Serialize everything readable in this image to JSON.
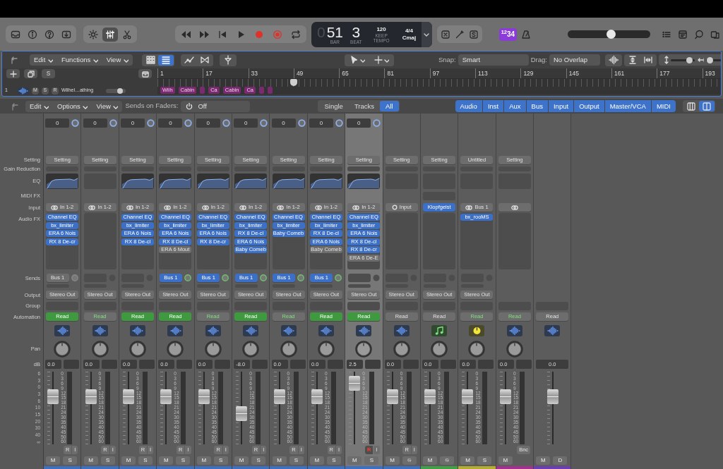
{
  "toolbar": {
    "view_buttons": [
      {
        "kind": "brightness",
        "selected": false
      },
      {
        "kind": "sliders",
        "selected": true
      },
      {
        "kind": "scissors",
        "selected": false
      }
    ],
    "lcd": {
      "dim_digit": "0",
      "bar": "51",
      "bar_label": "BAR",
      "beat": "3",
      "beat_label": "BEAT",
      "tempo": "120",
      "tempo_mode": "KEEP",
      "tempo_label": "TEMPO",
      "signature": "4/4",
      "key": "Cmaj"
    },
    "key_badge": "$^{12}$34",
    "master_volume": {
      "level": 0.52
    }
  },
  "tracks": {
    "menus": [
      "Edit",
      "Functions",
      "View"
    ],
    "view_toggle": [
      {
        "kind": "grid",
        "selected": false
      },
      {
        "kind": "list",
        "selected": true
      }
    ],
    "snap": {
      "label": "Snap:",
      "value": "Smart"
    },
    "drag": {
      "label": "Drag:",
      "value": "No Overlap"
    },
    "zoom": [
      {
        "kind": "vertical",
        "level": 0.78
      },
      {
        "kind": "horizontal",
        "level": 0.15
      }
    ],
    "header_button": "S",
    "ruler": [
      {
        "label": "1",
        "playhead": false
      },
      {
        "label": "17",
        "playhead": false
      },
      {
        "label": "33",
        "playhead": false
      },
      {
        "label": "49",
        "playhead": true
      },
      {
        "label": "65",
        "playhead": false
      },
      {
        "label": "81",
        "playhead": false
      },
      {
        "label": "97",
        "playhead": false
      },
      {
        "label": "113",
        "playhead": false
      },
      {
        "label": "129",
        "playhead": false
      },
      {
        "label": "145",
        "playhead": false
      },
      {
        "label": "161",
        "playhead": false
      },
      {
        "label": "177",
        "playhead": false
      },
      {
        "label": "193",
        "playhead": false
      }
    ],
    "track": {
      "number": "1",
      "buttons": [
        "M",
        "S",
        "R"
      ],
      "name": "Wilhel…athing",
      "volume": {
        "level": 0.7
      }
    },
    "regions": [
      {
        "kind": "labeled",
        "label": "Wilh"
      },
      {
        "kind": "labeled",
        "label": "Cabin"
      },
      {
        "kind": "blank"
      },
      {
        "kind": "labeled",
        "label": "Ca"
      },
      {
        "kind": "labeled",
        "label": "Cabin"
      },
      {
        "kind": "labeled",
        "label": "Ca"
      },
      {
        "kind": "blank"
      },
      {
        "kind": "blank"
      }
    ]
  },
  "mixer_header": {
    "menus": [
      "Edit",
      "Options",
      "View"
    ],
    "sends_on_faders": {
      "label": "Sends on Faders:",
      "value": "Off"
    },
    "scope": [
      {
        "label": "Single",
        "selected": false
      },
      {
        "label": "Tracks",
        "selected": false
      },
      {
        "label": "All",
        "selected": true
      }
    ],
    "filters": [
      {
        "label": "Audio",
        "on": true
      },
      {
        "label": "Inst",
        "on": true
      },
      {
        "label": "Aux",
        "on": true
      },
      {
        "label": "Bus",
        "on": true
      },
      {
        "label": "Input",
        "on": true
      },
      {
        "label": "Output",
        "on": true
      },
      {
        "label": "Master/VCA",
        "on": true
      },
      {
        "label": "MIDI",
        "on": true
      }
    ],
    "layouts": [
      {
        "kind": "narrow",
        "selected": false
      },
      {
        "kind": "wide",
        "selected": true
      }
    ]
  },
  "row_labels": [
    {
      "kind": "setting",
      "label": "Setting"
    },
    {
      "kind": "gr",
      "label": "Gain Reduction"
    },
    {
      "kind": "eq",
      "label": "EQ"
    },
    {
      "kind": "midi",
      "label": "MIDI FX"
    },
    {
      "kind": "input",
      "label": "Input"
    },
    {
      "kind": "fx",
      "label": "Audio FX"
    },
    {
      "kind": "sends",
      "label": "Sends"
    },
    {
      "kind": "output",
      "label": "Output"
    },
    {
      "kind": "group",
      "label": "Group"
    },
    {
      "kind": "auto",
      "label": "Automation"
    },
    {
      "kind": "pan",
      "label": "Pan"
    },
    {
      "kind": "db",
      "label": "dB"
    }
  ],
  "fader_scale": [
    "6",
    "3",
    "0",
    "3",
    "6",
    "10",
    "15",
    "20",
    "30",
    "40",
    "∞"
  ],
  "channels": [
    {
      "kind": "audio",
      "selected": false,
      "gain": "0",
      "setting": "Setting",
      "eq": {
        "kind": "curve"
      },
      "input": {
        "kind": "stereo",
        "label": "In 1-2"
      },
      "audio_fx": [
        {
          "name": "Channel EQ",
          "active": true
        },
        {
          "name": "bx_limiter",
          "active": true
        },
        {
          "name": "ERA 6 Nois",
          "active": true
        },
        {
          "name": "RX 8 De-cr",
          "active": true
        }
      ],
      "send": {
        "label": "Bus 1",
        "active": false
      },
      "output": "Stereo Out",
      "automation": {
        "label": "Read",
        "kind": "filled"
      },
      "track_icon": {
        "kind": "waveform"
      },
      "db": "0.0",
      "fader": {
        "level": 0.7
      },
      "meter_scale": [
        "0",
        "3",
        "6",
        "9",
        "12",
        "15",
        "18",
        "21",
        "24",
        "30",
        "35",
        "40",
        "45",
        "50",
        "60"
      ],
      "top_buttons": [
        {
          "label": "R",
          "armed": false
        },
        {
          "label": "I",
          "armed": false
        }
      ],
      "buttons": [
        {
          "label": "M",
          "disabled": false
        },
        {
          "label": "S",
          "disabled": false
        }
      ],
      "color": "#3f6fc0"
    },
    {
      "kind": "audio",
      "selected": false,
      "gain": "0",
      "setting": "Setting",
      "eq": {
        "kind": "empty"
      },
      "input": {
        "kind": "stereo",
        "label": "In 1-2"
      },
      "output": "Stereo Out",
      "automation": {
        "label": "Read",
        "kind": "lit"
      },
      "track_icon": {
        "kind": "waveform"
      },
      "db": "0.0",
      "fader": {
        "level": 0.7
      },
      "meter_scale": [
        "0",
        "3",
        "6",
        "9",
        "12",
        "15",
        "18",
        "21",
        "24",
        "30",
        "35",
        "40",
        "45",
        "50",
        "60"
      ],
      "top_buttons": [
        {
          "label": "R",
          "armed": false
        },
        {
          "label": "I",
          "armed": false
        }
      ],
      "buttons": [
        {
          "label": "M",
          "disabled": false
        },
        {
          "label": "S",
          "disabled": false
        }
      ],
      "color": "#3f6fc0"
    },
    {
      "kind": "audio",
      "selected": false,
      "gain": "0",
      "setting": "Setting",
      "eq": {
        "kind": "curve"
      },
      "input": {
        "kind": "stereo",
        "label": "In 1-2"
      },
      "audio_fx": [
        {
          "name": "Channel EQ",
          "active": true
        },
        {
          "name": "bx_limiter",
          "active": true
        },
        {
          "name": "ERA 6 Nois",
          "active": true
        },
        {
          "name": "RX 8 De-cl",
          "active": true
        }
      ],
      "output": "Stereo Out",
      "automation": {
        "label": "Read",
        "kind": "filled"
      },
      "track_icon": {
        "kind": "waveform"
      },
      "db": "0.0",
      "fader": {
        "level": 0.7
      },
      "meter_scale": [
        "0",
        "3",
        "6",
        "9",
        "12",
        "15",
        "18",
        "21",
        "24",
        "30",
        "35",
        "40",
        "45",
        "50",
        "60"
      ],
      "top_buttons": [
        {
          "label": "R",
          "armed": false
        },
        {
          "label": "I",
          "armed": false
        }
      ],
      "buttons": [
        {
          "label": "M",
          "disabled": false
        },
        {
          "label": "S",
          "disabled": false
        }
      ],
      "color": "#3f6fc0"
    },
    {
      "kind": "audio",
      "selected": false,
      "gain": "0",
      "setting": "Setting",
      "eq": {
        "kind": "curve"
      },
      "input": {
        "kind": "stereo",
        "label": "In 1-2"
      },
      "audio_fx": [
        {
          "name": "Channel EQ",
          "active": true
        },
        {
          "name": "bx_limiter",
          "active": true
        },
        {
          "name": "ERA 6 Nois",
          "active": true
        },
        {
          "name": "RX 8 De-cl",
          "active": true
        },
        {
          "name": "ERA 6 Mout",
          "active": false
        }
      ],
      "send": {
        "label": "Bus 1",
        "active": true
      },
      "output": "Stereo Out",
      "automation": {
        "label": "Read",
        "kind": "filled"
      },
      "track_icon": {
        "kind": "waveform"
      },
      "db": "0.0",
      "fader": {
        "level": 0.7
      },
      "meter_scale": [
        "0",
        "3",
        "6",
        "9",
        "12",
        "15",
        "18",
        "21",
        "24",
        "30",
        "35",
        "40",
        "45",
        "50",
        "60"
      ],
      "top_buttons": [
        {
          "label": "R",
          "armed": false
        },
        {
          "label": "I",
          "armed": false
        }
      ],
      "buttons": [
        {
          "label": "M",
          "disabled": false
        },
        {
          "label": "S",
          "disabled": false
        }
      ],
      "color": "#3f6fc0"
    },
    {
      "kind": "audio",
      "selected": false,
      "gain": "0",
      "setting": "Setting",
      "eq": {
        "kind": "curve"
      },
      "input": {
        "kind": "stereo",
        "label": "In 1-2"
      },
      "audio_fx": [
        {
          "name": "Channel EQ",
          "active": true
        },
        {
          "name": "bx_limiter",
          "active": true
        },
        {
          "name": "ERA 6 Nois",
          "active": true
        },
        {
          "name": "RX 8 De-cr",
          "active": true
        }
      ],
      "send": {
        "label": "Bus 1",
        "active": true
      },
      "output": "Stereo Out",
      "automation": {
        "label": "Read",
        "kind": "lit"
      },
      "track_icon": {
        "kind": "waveform"
      },
      "db": "0.0",
      "fader": {
        "level": 0.7
      },
      "meter_scale": [
        "0",
        "3",
        "6",
        "9",
        "12",
        "15",
        "18",
        "21",
        "24",
        "30",
        "35",
        "40",
        "45",
        "50",
        "60"
      ],
      "top_buttons": [
        {
          "label": "R",
          "armed": false
        },
        {
          "label": "I",
          "armed": false
        }
      ],
      "buttons": [
        {
          "label": "M",
          "disabled": false
        },
        {
          "label": "S",
          "disabled": false
        }
      ],
      "color": "#3f6fc0"
    },
    {
      "kind": "audio",
      "selected": false,
      "gain": "0",
      "setting": "Setting",
      "eq": {
        "kind": "curve"
      },
      "input": {
        "kind": "stereo",
        "label": "In 1-2"
      },
      "audio_fx": [
        {
          "name": "Channel EQ",
          "active": true
        },
        {
          "name": "bx_limiter",
          "active": true
        },
        {
          "name": "RX 8 De-cl",
          "active": true
        },
        {
          "name": "ERA 6 Nois",
          "active": true
        },
        {
          "name": "Baby Comeb",
          "active": true
        }
      ],
      "send": {
        "label": "Bus 1",
        "active": true
      },
      "output": "Stereo Out",
      "automation": {
        "label": "Read",
        "kind": "filled"
      },
      "track_icon": {
        "kind": "waveform"
      },
      "db": "-8.0",
      "fader": {
        "level": 0.4
      },
      "meter_scale": [
        "0",
        "3",
        "6",
        "9",
        "12",
        "15",
        "18",
        "21",
        "24",
        "30",
        "35",
        "40",
        "45",
        "50",
        "60"
      ],
      "top_buttons": [
        {
          "label": "R",
          "armed": false
        },
        {
          "label": "I",
          "armed": false
        }
      ],
      "buttons": [
        {
          "label": "M",
          "disabled": false
        },
        {
          "label": "S",
          "disabled": false
        }
      ],
      "color": "#3f6fc0"
    },
    {
      "kind": "audio",
      "selected": false,
      "gain": "0",
      "setting": "Setting",
      "eq": {
        "kind": "curve"
      },
      "input": {
        "kind": "stereo",
        "label": "In 1-2"
      },
      "audio_fx": [
        {
          "name": "Channel EQ",
          "active": true
        },
        {
          "name": "bx_limiter",
          "active": true
        },
        {
          "name": "Baby Comeb",
          "active": true
        }
      ],
      "send": {
        "label": "Bus 1",
        "active": true
      },
      "output": "Stereo Out",
      "automation": {
        "label": "Read",
        "kind": "lit"
      },
      "track_icon": {
        "kind": "waveform"
      },
      "db": "0.0",
      "fader": {
        "level": 0.7
      },
      "meter_scale": [
        "0",
        "3",
        "6",
        "9",
        "12",
        "15",
        "18",
        "21",
        "24",
        "30",
        "35",
        "40",
        "45",
        "50",
        "60"
      ],
      "top_buttons": [
        {
          "label": "R",
          "armed": false
        },
        {
          "label": "I",
          "armed": false
        }
      ],
      "buttons": [
        {
          "label": "M",
          "disabled": false
        },
        {
          "label": "S",
          "disabled": false
        }
      ],
      "color": "#3f6fc0"
    },
    {
      "kind": "audio",
      "selected": false,
      "gain": "0",
      "setting": "Setting",
      "eq": {
        "kind": "curve"
      },
      "input": {
        "kind": "stereo",
        "label": "In 1-2"
      },
      "audio_fx": [
        {
          "name": "Channel EQ",
          "active": true
        },
        {
          "name": "bx_limiter",
          "active": true
        },
        {
          "name": "RX 8 De-cl",
          "active": true
        },
        {
          "name": "ERA 6 Nois",
          "active": true
        },
        {
          "name": "Baby Comeb",
          "active": false
        }
      ],
      "send": {
        "label": "Bus 1",
        "active": true
      },
      "output": "Stereo Out",
      "automation": {
        "label": "Read",
        "kind": "filled"
      },
      "track_icon": {
        "kind": "waveform"
      },
      "db": "0.0",
      "fader": {
        "level": 0.7
      },
      "meter_scale": [
        "0",
        "3",
        "6",
        "9",
        "12",
        "15",
        "18",
        "21",
        "24",
        "30",
        "35",
        "40",
        "45",
        "50",
        "60"
      ],
      "top_buttons": [
        {
          "label": "R",
          "armed": false
        },
        {
          "label": "I",
          "armed": false
        }
      ],
      "buttons": [
        {
          "label": "M",
          "disabled": false
        },
        {
          "label": "S",
          "disabled": false
        }
      ],
      "color": "#3f6fc0"
    },
    {
      "kind": "audio",
      "selected": true,
      "gain": "0",
      "setting": "Setting",
      "eq": {
        "kind": "curve"
      },
      "input": {
        "kind": "stereo",
        "label": "In 1-2"
      },
      "audio_fx": [
        {
          "name": "Channel EQ",
          "active": true
        },
        {
          "name": "bx_limiter",
          "active": true
        },
        {
          "name": "ERA 6 Nois",
          "active": true
        },
        {
          "name": "RX 8 De-cl",
          "active": true
        },
        {
          "name": "RX 8 De-cr",
          "active": true
        },
        {
          "name": "ERA 6 De-E",
          "active": false
        }
      ],
      "output": "Stereo Out",
      "automation": {
        "label": "Read",
        "kind": "filled"
      },
      "track_icon": {
        "kind": "waveform"
      },
      "db": "2.5",
      "fader": {
        "level": 0.93
      },
      "meter_scale": [
        "0",
        "3",
        "6",
        "9",
        "12",
        "15",
        "18",
        "21",
        "24",
        "30",
        "35",
        "40",
        "45",
        "50",
        "60"
      ],
      "top_buttons": [
        {
          "label": "R",
          "armed": true
        },
        {
          "label": "I",
          "armed": false
        }
      ],
      "buttons": [
        {
          "label": "M",
          "disabled": false
        },
        {
          "label": "S",
          "disabled": false
        }
      ],
      "color": "#3f6fc0"
    },
    {
      "kind": "audio",
      "selected": false,
      "setting": "Setting",
      "eq": {
        "kind": "empty"
      },
      "input": {
        "kind": "mono",
        "label": "Input"
      },
      "output": "Stereo Out",
      "automation": {
        "label": "Read",
        "kind": "plain"
      },
      "track_icon": {
        "kind": "waveform"
      },
      "db": "0.0",
      "fader": {
        "level": 0.7
      },
      "meter_scale": [
        "0",
        "3",
        "6",
        "9",
        "12",
        "15",
        "18",
        "21",
        "24",
        "30",
        "35",
        "40",
        "45",
        "50",
        "60"
      ],
      "top_buttons": [
        {
          "label": "R",
          "armed": false
        },
        {
          "label": "I",
          "armed": false
        }
      ],
      "buttons": [
        {
          "label": "M",
          "disabled": false
        },
        {
          "label": "S",
          "disabled": true
        }
      ],
      "color": "#3f6fc0"
    },
    {
      "kind": "instrument",
      "selected": false,
      "setting": "Setting",
      "eq": {
        "kind": "empty"
      },
      "midi_fx_slot": true,
      "input": {
        "kind": "plugin",
        "label": "Klopfgeist"
      },
      "output": "Stereo Out",
      "automation": {
        "label": "Read",
        "kind": "plain"
      },
      "track_icon": {
        "kind": "note"
      },
      "db": "0.0",
      "fader": {
        "level": 0.7
      },
      "meter_scale": [
        "0",
        "3",
        "6",
        "9",
        "12",
        "15",
        "18",
        "21",
        "24",
        "30",
        "35",
        "40",
        "45",
        "50",
        "60"
      ],
      "buttons": [
        {
          "label": "M",
          "disabled": false
        },
        {
          "label": "S",
          "disabled": true
        }
      ],
      "color": "#3fa048"
    },
    {
      "kind": "aux",
      "selected": false,
      "setting": "Untitled",
      "eq": {
        "kind": "empty"
      },
      "input": {
        "kind": "stereo",
        "label": "Bus 1"
      },
      "audio_fx": [
        {
          "name": "bx_rooMS",
          "active": true
        }
      ],
      "output": "Stereo Out",
      "automation": {
        "label": "Read",
        "kind": "lit"
      },
      "track_icon": {
        "kind": "dial"
      },
      "db": "0.0",
      "fader": {
        "level": 0.7
      },
      "meter_scale": [
        "0",
        "3",
        "6",
        "9",
        "12",
        "15",
        "18",
        "21",
        "24",
        "30",
        "35",
        "40",
        "45",
        "50",
        "60"
      ],
      "buttons": [
        {
          "label": "M",
          "disabled": false
        },
        {
          "label": "S",
          "disabled": false
        }
      ],
      "color": "#b5ad2e"
    },
    {
      "kind": "output",
      "selected": false,
      "setting": "Setting",
      "eq": {
        "kind": "empty"
      },
      "input": {
        "kind": "stereo"
      },
      "automation": {
        "label": "Read",
        "kind": "lit"
      },
      "track_icon": {
        "kind": "waveform"
      },
      "db": "0.0",
      "fader": {
        "level": 0.7
      },
      "meter_scale": [
        "0",
        "3",
        "6",
        "9",
        "12",
        "15",
        "18",
        "21",
        "24",
        "30",
        "35",
        "40",
        "45",
        "50",
        "60"
      ],
      "top_buttons": [
        {
          "label": "Bnc",
          "armed": false
        }
      ],
      "buttons": [
        {
          "label": "M",
          "disabled": false
        }
      ],
      "color": "#a3308f"
    },
    {
      "kind": "master",
      "selected": false,
      "automation": {
        "label": "Read",
        "kind": "plain"
      },
      "track_icon": {
        "kind": "waveform"
      },
      "db": "0.0",
      "fader": {
        "level": 0.7
      },
      "buttons": [
        {
          "label": "M",
          "disabled": false
        },
        {
          "label": "D",
          "disabled": false
        }
      ],
      "color": "#6c3cb4"
    }
  ]
}
